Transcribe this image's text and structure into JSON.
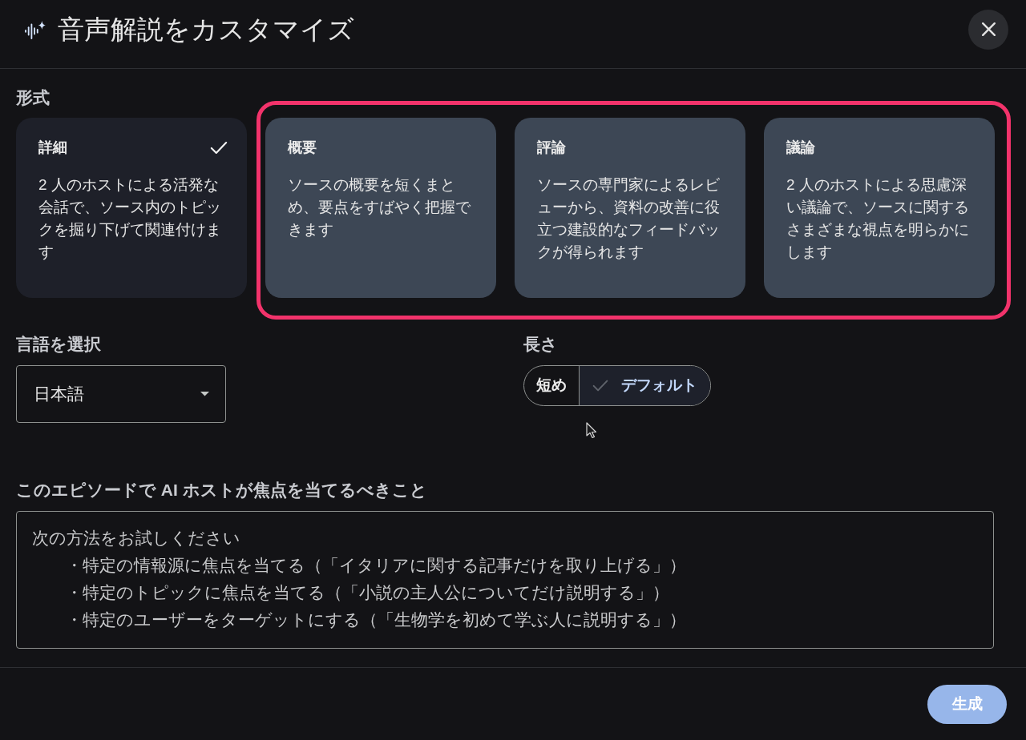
{
  "dialog": {
    "title": "音声解説をカスタマイズ"
  },
  "format": {
    "label": "形式",
    "options": [
      {
        "title": "詳細",
        "description": "2 人のホストによる活発な会話で、ソース内のトピックを掘り下げて関連付けます",
        "selected": true,
        "highlighted": false
      },
      {
        "title": "概要",
        "description": "ソースの概要を短くまとめ、要点をすばやく把握できます",
        "selected": false,
        "highlighted": true
      },
      {
        "title": "評論",
        "description": "ソースの専門家によるレビューから、資料の改善に役立つ建設的なフィードバックが得られます",
        "selected": false,
        "highlighted": true
      },
      {
        "title": "議論",
        "description": "2 人のホストによる思慮深い議論で、ソースに関するさまざまな視点を明らかにします",
        "selected": false,
        "highlighted": true
      }
    ]
  },
  "language": {
    "label": "言語を選択",
    "value": "日本語"
  },
  "length": {
    "label": "長さ",
    "options": [
      {
        "label": "短め",
        "selected": false
      },
      {
        "label": "デフォルト",
        "selected": true
      }
    ]
  },
  "focus": {
    "label": "このエピソードで AI ホストが焦点を当てるべきこと",
    "placeholder": [
      "次の方法をお試しください",
      "・特定の情報源に焦点を当てる（「イタリアに関する記事だけを取り上げる」）",
      "・特定のトピックに焦点を当てる（「小説の主人公についてだけ説明する」）",
      "・特定のユーザーをターゲットにする（「生物学を初めて学ぶ人に説明する」）"
    ]
  },
  "buttons": [
    {
      "label": "生成",
      "disabled": true
    }
  ]
}
